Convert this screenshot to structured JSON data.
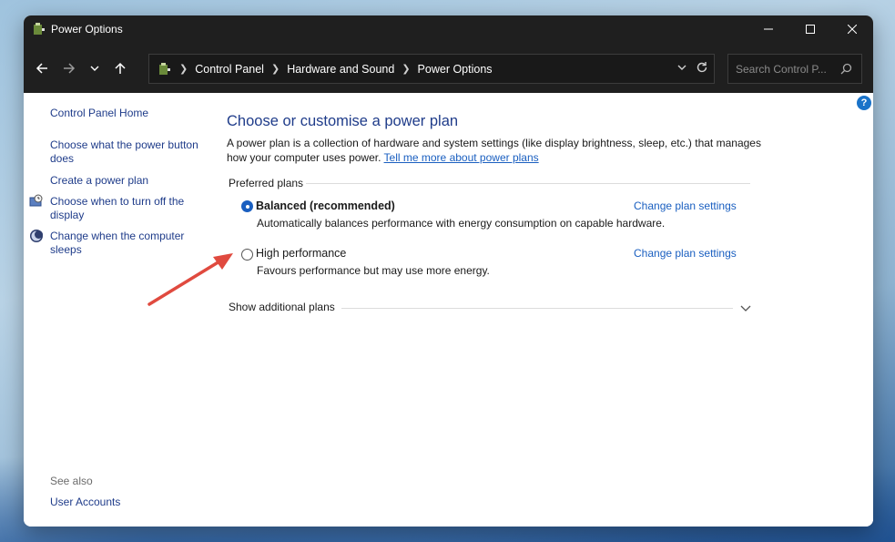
{
  "window": {
    "title": "Power Options",
    "controls": {
      "minimize": "—",
      "maximize": "☐",
      "close": "✕"
    }
  },
  "address": {
    "crumbs": [
      "Control Panel",
      "Hardware and Sound",
      "Power Options"
    ],
    "search_placeholder": "Search Control P..."
  },
  "sidebar": {
    "home": "Control Panel Home",
    "links": [
      "Choose what the power button does",
      "Create a power plan",
      "Choose when to turn off the display",
      "Change when the computer sleeps"
    ],
    "see_also_label": "See also",
    "see_also_link": "User Accounts"
  },
  "main": {
    "heading": "Choose or customise a power plan",
    "description": "A power plan is a collection of hardware and system settings (like display brightness, sleep, etc.) that manages how your computer uses power.",
    "learn_more": "Tell me more about power plans",
    "group_label": "Preferred plans",
    "plans": [
      {
        "name": "Balanced (recommended)",
        "desc": "Automatically balances performance with energy consumption on capable hardware.",
        "link": "Change plan settings",
        "selected": true
      },
      {
        "name": "High performance",
        "desc": "Favours performance but may use more energy.",
        "link": "Change plan settings",
        "selected": false
      }
    ],
    "additional_plans": "Show additional plans"
  },
  "colors": {
    "accent": "#1a5fc0",
    "link": "#1f3c8a",
    "annotation_arrow": "#e04a3f"
  }
}
